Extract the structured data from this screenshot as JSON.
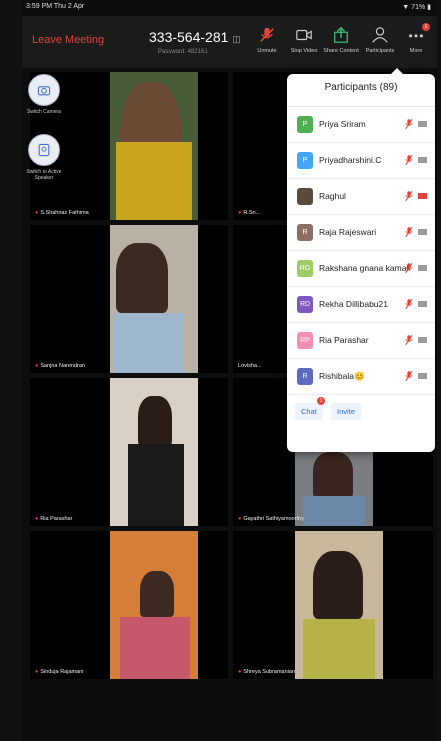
{
  "status": {
    "time": "3:59 PM  Thu 2 Apr",
    "battery": "71%"
  },
  "topbar": {
    "leave_label": "Leave Meeting",
    "meeting_id": "333-564-281",
    "password": "Password: 482161",
    "unmute": "Unmute",
    "stop_video": "Stop Video",
    "share_content": "Share Content",
    "participants": "Participants",
    "more": "More",
    "more_badge": "1"
  },
  "sidebuttons": {
    "switch_camera": "Switch Camera",
    "switch_speaker": "Switch to Active Speaker"
  },
  "tiles": [
    {
      "name": "S.Shahnaz Fathima"
    },
    {
      "name": "R.Sn..."
    },
    {
      "name": "Sanjna Narendran"
    },
    {
      "name": "Lovisha..."
    },
    {
      "name": "Ria Parashar"
    },
    {
      "name": "Gayathri Sathiyamoorthy"
    },
    {
      "name": "Sinduja Rajamani"
    },
    {
      "name": "Shreya Subramanian"
    }
  ],
  "participants_panel": {
    "title": "Participants (89)",
    "items": [
      {
        "initial": "P",
        "name": "Priya Sriram",
        "color": "#4caf50",
        "video_off_red": false
      },
      {
        "initial": "P",
        "name": "Priyadharshini.C",
        "color": "#42a5f5",
        "video_off_red": false
      },
      {
        "initial": "",
        "name": "Raghul",
        "color": "#5a4a3a",
        "video_off_red": true
      },
      {
        "initial": "R",
        "name": "Raja Rajeswari",
        "color": "#8d6e63",
        "video_off_red": false
      },
      {
        "initial": "RG",
        "name": "Rakshana gnana kamali",
        "color": "#9ccc65",
        "video_off_red": false
      },
      {
        "initial": "RD",
        "name": "Rekha Dillibabu21",
        "color": "#7e57c2",
        "video_off_red": false
      },
      {
        "initial": "RP",
        "name": "Ria Parashar",
        "color": "#f48fb1",
        "video_off_red": false
      },
      {
        "initial": "R",
        "name": "Rishibala😊",
        "color": "#5c6bc0",
        "video_off_red": false
      }
    ],
    "chat_label": "Chat",
    "chat_badge": "1",
    "invite_label": "Invite"
  },
  "colors": {
    "accent_red": "#e0443a",
    "link_blue": "#2d6fe0"
  }
}
